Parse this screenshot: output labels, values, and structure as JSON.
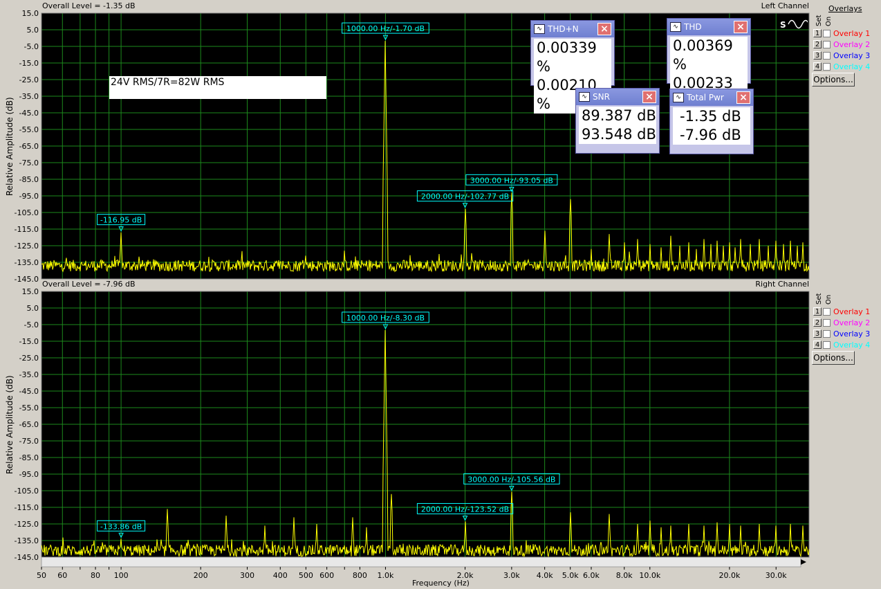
{
  "panels": [
    {
      "overall_level": "Overall Level = -1.35 dB",
      "channel": "Left Channel",
      "ylabel": "Relative Amplitude (dB)",
      "markers": [
        {
          "freq": 1000,
          "db": -1.7,
          "label": "1000.00 Hz/-1.70 dB"
        },
        {
          "freq": 3000,
          "db": -93.05,
          "label": "3000.00 Hz/-93.05 dB"
        },
        {
          "freq": 2000,
          "db": -102.77,
          "label": "2000.00 Hz/-102.77 dB"
        },
        {
          "freq": 100,
          "db": -116.95,
          "label": "-116.95 dB"
        }
      ]
    },
    {
      "overall_level": "Overall Level = -7.96 dB",
      "channel": "Right Channel",
      "ylabel": "Relative Amplitude (dB)",
      "markers": [
        {
          "freq": 1000,
          "db": -8.3,
          "label": "1000.00 Hz/-8.30 dB"
        },
        {
          "freq": 3000,
          "db": -105.56,
          "label": "3000.00 Hz/-105.56 dB"
        },
        {
          "freq": 2000,
          "db": -123.52,
          "label": "2000.00 Hz/-123.52 dB"
        },
        {
          "freq": 100,
          "db": -133.86,
          "label": "-133.86 dB"
        }
      ]
    }
  ],
  "annotation": "24V RMS/7R=82W RMS",
  "overlays": {
    "title": "Overlays",
    "set_label": "Set",
    "on_label": "On",
    "options_label": "Options...",
    "items": [
      {
        "num": "1",
        "label": "Overlay 1",
        "color": "#ff0000"
      },
      {
        "num": "2",
        "label": "Overlay 2",
        "color": "#ff00ff"
      },
      {
        "num": "3",
        "label": "Overlay 3",
        "color": "#0000ff"
      },
      {
        "num": "4",
        "label": "Overlay 4",
        "color": "#00ffff"
      }
    ]
  },
  "meters": {
    "thdn": {
      "title": "THD+N",
      "values": [
        "0.00339 %",
        "0.00210 %"
      ]
    },
    "thd": {
      "title": "THD",
      "values": [
        "0.00369 %",
        "0.00233 %"
      ]
    },
    "snr": {
      "title": "SNR",
      "values": [
        "89.387 dB",
        "93.548 dB"
      ]
    },
    "total_pwr": {
      "title": "Total Pwr",
      "values": [
        "-1.35 dB",
        "-7.96 dB"
      ]
    }
  },
  "xlabel": "Frequency (Hz)",
  "chart_data": [
    {
      "type": "line",
      "title": "Left Channel",
      "xlabel": "Frequency (Hz)",
      "ylabel": "Relative Amplitude (dB)",
      "x_scale": "log",
      "xlim": [
        50,
        40000
      ],
      "ylim": [
        -145,
        15
      ],
      "yticks": [
        15,
        5,
        -5,
        -15,
        -25,
        -35,
        -45,
        -55,
        -65,
        -75,
        -85,
        -95,
        -105,
        -115,
        -125,
        -135,
        -145
      ],
      "xticks": [
        50,
        60,
        70,
        80,
        90,
        100,
        200,
        300,
        400,
        500,
        600,
        700,
        800,
        1000,
        2000,
        3000,
        4000,
        5000,
        6000,
        8000,
        10000,
        20000,
        30000
      ],
      "xtick_labels": [
        "50",
        "60",
        "",
        "80",
        "",
        "100",
        "200",
        "300",
        "400",
        "500",
        "600",
        "",
        "800",
        "1.0k",
        "2.0k",
        "3.0k",
        "4.0k",
        "5.0k",
        "6.0k",
        "8.0k",
        "10.0k",
        "20.0k",
        "30.0k"
      ],
      "grid": true,
      "noise_floor_db": -137,
      "peaks": [
        [
          100,
          -117
        ],
        [
          1000,
          -1.7
        ],
        [
          2000,
          -102.8
        ],
        [
          3000,
          -93.1
        ],
        [
          4000,
          -116
        ],
        [
          5000,
          -97
        ],
        [
          6000,
          -127
        ],
        [
          7000,
          -118
        ],
        [
          8000,
          -123
        ],
        [
          9000,
          -121
        ],
        [
          10000,
          -124
        ],
        [
          11000,
          -126
        ],
        [
          12000,
          -119
        ],
        [
          13000,
          -125
        ],
        [
          14000,
          -123
        ],
        [
          15000,
          -127
        ],
        [
          16000,
          -121
        ],
        [
          17000,
          -124
        ],
        [
          18000,
          -122
        ],
        [
          19000,
          -125
        ],
        [
          20000,
          -123
        ],
        [
          21000,
          -126
        ],
        [
          22000,
          -121
        ],
        [
          24000,
          -124
        ],
        [
          26000,
          -121
        ],
        [
          28000,
          -125
        ],
        [
          30000,
          -122
        ],
        [
          32000,
          -124
        ],
        [
          34000,
          -122
        ],
        [
          36000,
          -125
        ],
        [
          38000,
          -123
        ],
        [
          700,
          -128
        ],
        [
          1600,
          -130
        ],
        [
          500,
          -131
        ]
      ]
    },
    {
      "type": "line",
      "title": "Right Channel",
      "xlabel": "Frequency (Hz)",
      "ylabel": "Relative Amplitude (dB)",
      "x_scale": "log",
      "xlim": [
        50,
        40000
      ],
      "ylim": [
        -145,
        15
      ],
      "grid": true,
      "noise_floor_db": -141,
      "peaks": [
        [
          100,
          -134
        ],
        [
          150,
          -116
        ],
        [
          250,
          -120
        ],
        [
          350,
          -126
        ],
        [
          450,
          -121
        ],
        [
          550,
          -125
        ],
        [
          750,
          -121
        ],
        [
          850,
          -127
        ],
        [
          1000,
          -8.3
        ],
        [
          1050,
          -107
        ],
        [
          2000,
          -123.5
        ],
        [
          3000,
          -105.6
        ],
        [
          5000,
          -118
        ],
        [
          7000,
          -119
        ],
        [
          9000,
          -125
        ],
        [
          10000,
          -123
        ],
        [
          11000,
          -127
        ],
        [
          12000,
          -126
        ],
        [
          14000,
          -125
        ],
        [
          16000,
          -126
        ],
        [
          18000,
          -124
        ],
        [
          20000,
          -125
        ],
        [
          22000,
          -126
        ],
        [
          26000,
          -125
        ],
        [
          30000,
          -126
        ],
        [
          34000,
          -125
        ],
        [
          38000,
          -126
        ]
      ]
    }
  ]
}
